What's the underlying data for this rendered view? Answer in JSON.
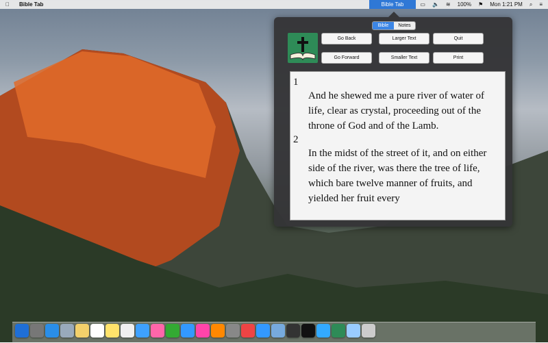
{
  "menubar": {
    "apple": "",
    "app_name": "Bible Tab",
    "active_item": "Bible Tab",
    "battery": "100%",
    "clock": "Mon 1:21 PM"
  },
  "popover": {
    "tabs": [
      {
        "label": "Bible",
        "selected": true
      },
      {
        "label": "Notes",
        "selected": false
      }
    ],
    "buttons": {
      "go_back": "Go Back",
      "larger_text": "Larger Text",
      "quit": "Quit",
      "go_forward": "Go Forward",
      "smaller_text": "Smaller Text",
      "print": "Print"
    },
    "verses": [
      {
        "num": "1",
        "text": "And he shewed me a pure river of water of life, clear as crystal, proceeding out of the throne of God and of the Lamb."
      },
      {
        "num": "2",
        "text": "In the midst of the street of it, and on either side of the river, was there the tree of life, which bare twelve manner of fruits, and yielded her fruit every"
      }
    ]
  },
  "dock_icons": [
    "finder-icon",
    "launchpad-icon",
    "safari-icon",
    "mail-icon",
    "notes-icon",
    "calendar-icon",
    "stickies-icon",
    "reminders-icon",
    "messages-icon",
    "photos-icon",
    "numbers-icon",
    "keynote-icon",
    "itunes-icon",
    "ibooks-icon",
    "system-prefs-icon",
    "chrome-icon",
    "app-store-icon",
    "preview-icon",
    "activity-monitor-icon",
    "terminal-icon",
    "xcode-icon",
    "bible-tab-icon",
    "downloads-icon",
    "trash-icon"
  ]
}
